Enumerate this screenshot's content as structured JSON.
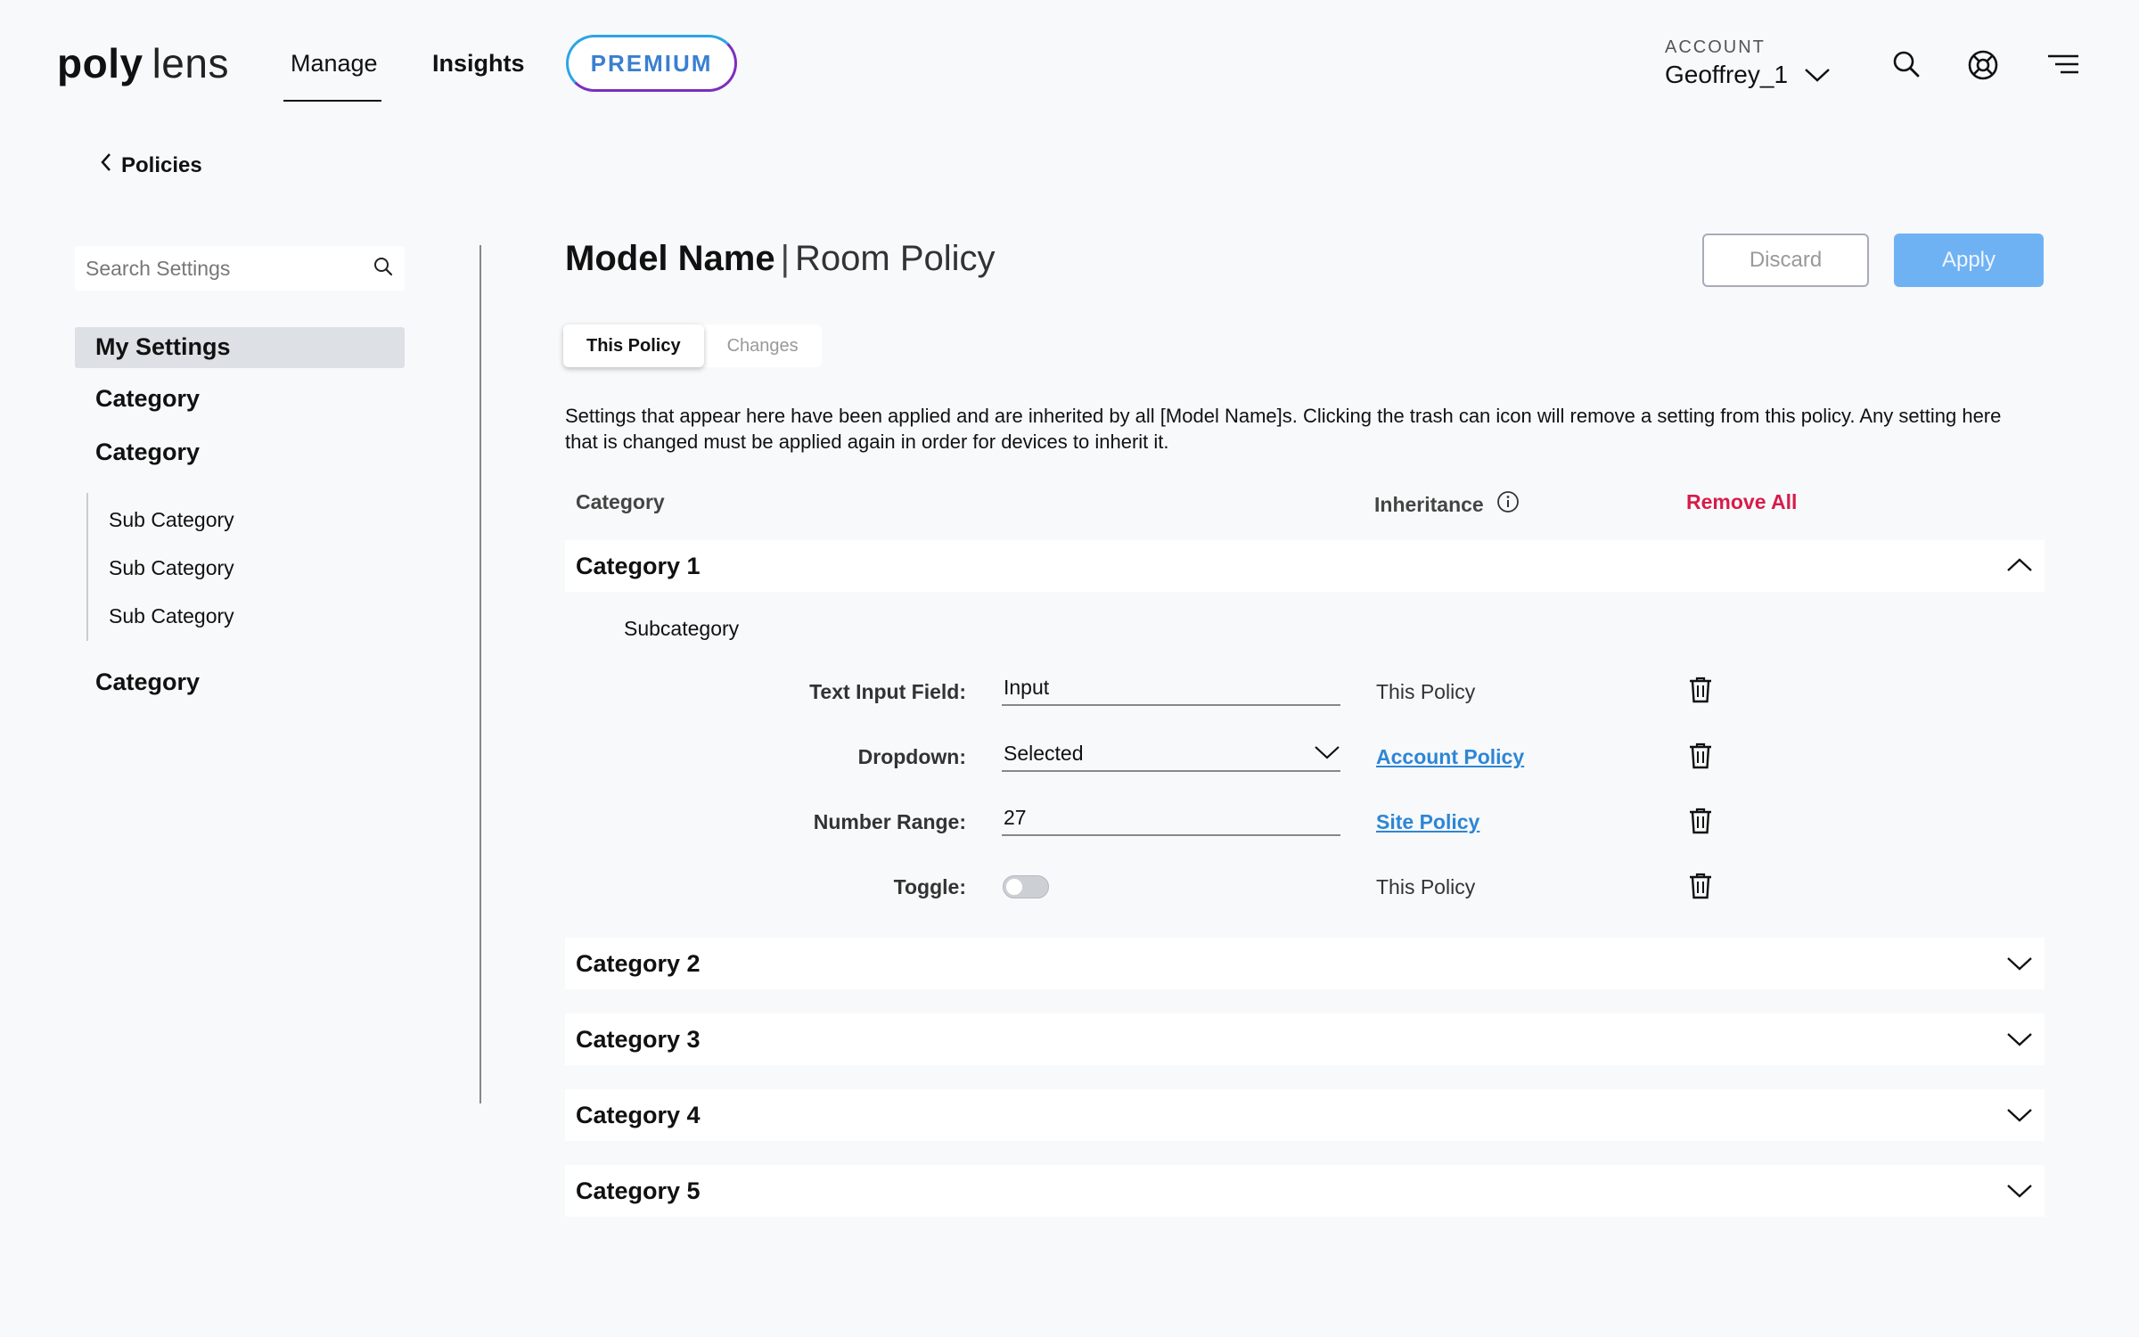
{
  "header": {
    "logo_bold": "poly",
    "logo_light": "lens",
    "nav": [
      {
        "label": "Manage"
      },
      {
        "label": "Insights"
      }
    ],
    "premium_label": "PREMIUM",
    "account_label": "ACCOUNT",
    "account_name": "Geoffrey_1",
    "icons": [
      "search-icon",
      "help-icon",
      "menu-icon"
    ]
  },
  "sidebar": {
    "back_label": "Policies",
    "search_placeholder": "Search Settings",
    "items": [
      {
        "label": "My Settings"
      },
      {
        "label": "Category"
      },
      {
        "label": "Category"
      },
      {
        "label": "Sub Category"
      },
      {
        "label": "Sub Category"
      },
      {
        "label": "Sub Category"
      },
      {
        "label": "Category"
      }
    ]
  },
  "main": {
    "title_bold": "Model Name",
    "title_sep": "|",
    "title_sub": "Room Policy",
    "discard_label": "Discard",
    "apply_label": "Apply",
    "tabs": [
      {
        "label": "This Policy"
      },
      {
        "label": "Changes"
      }
    ],
    "description": "Settings that appear here have been applied and are inherited by all [Model Name]s. Clicking the trash can icon will remove a setting from this policy. Any setting here that is changed must be applied again in order for devices to inherit it.",
    "columns": {
      "category": "Category",
      "inheritance": "Inheritance",
      "remove_all": "Remove All"
    },
    "categories": [
      {
        "label": "Category 1",
        "expanded": true
      },
      {
        "label": "Category 2",
        "expanded": false
      },
      {
        "label": "Category 3",
        "expanded": false
      },
      {
        "label": "Category 4",
        "expanded": false
      },
      {
        "label": "Category 5",
        "expanded": false
      }
    ],
    "subcategory": "Subcategory",
    "fields": [
      {
        "label": "Text Input Field:",
        "value": "Input",
        "inheritance": "This Policy"
      },
      {
        "label": "Dropdown:",
        "value": "Selected",
        "inheritance": "Account Policy"
      },
      {
        "label": "Number Range:",
        "value": "27",
        "inheritance": "Site Policy"
      },
      {
        "label": "Toggle:",
        "value": "off",
        "inheritance": "This Policy"
      }
    ]
  },
  "colors": {
    "background": "#f8f9fa",
    "apply": "#6fb2f4",
    "remove_all": "#d81b4a",
    "link": "#2d86d6",
    "premium_gradient_start": "#2aa5e5",
    "premium_gradient_end": "#7b2fbe"
  }
}
